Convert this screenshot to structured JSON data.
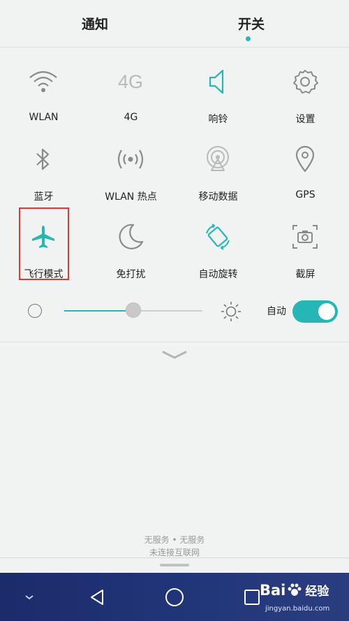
{
  "tabs": [
    {
      "label": "通知",
      "active": false
    },
    {
      "label": "开关",
      "active": true
    }
  ],
  "toggles": [
    {
      "label": "WLAN",
      "icon": "wifi-icon",
      "active": false
    },
    {
      "label": "4G",
      "icon": "4g-icon",
      "icon_text": "4G",
      "active": false
    },
    {
      "label": "响铃",
      "icon": "speaker-icon",
      "active": true
    },
    {
      "label": "设置",
      "icon": "gear-icon",
      "active": false
    },
    {
      "label": "蓝牙",
      "icon": "bluetooth-icon",
      "active": false
    },
    {
      "label": "WLAN 热点",
      "icon": "hotspot-icon",
      "active": false
    },
    {
      "label": "移动数据",
      "icon": "mobile-data-icon",
      "active": false
    },
    {
      "label": "GPS",
      "icon": "location-pin-icon",
      "active": false
    },
    {
      "label": "飞行模式",
      "icon": "airplane-icon",
      "active": true,
      "highlighted": true
    },
    {
      "label": "免打扰",
      "icon": "moon-icon",
      "active": false
    },
    {
      "label": "自动旋转",
      "icon": "auto-rotate-icon",
      "active": true
    },
    {
      "label": "截屏",
      "icon": "screenshot-icon",
      "active": false
    }
  ],
  "brightness": {
    "level": 0.5,
    "auto_label": "自动",
    "auto_enabled": true
  },
  "status": {
    "line1": "无服务 • 无服务",
    "line2": "未连接互联网"
  },
  "navbar": {
    "items": [
      "collapse-icon",
      "back-icon",
      "home-icon",
      "recents-icon"
    ]
  },
  "watermark": {
    "brand": "Bai",
    "brand_sub": "经验",
    "url": "jingyan.baidu.com"
  },
  "colors": {
    "accent": "#27b6b6",
    "inactive_icon": "#8a8a8a",
    "highlight_box": "#d63b3b",
    "navbar": "#203578"
  }
}
